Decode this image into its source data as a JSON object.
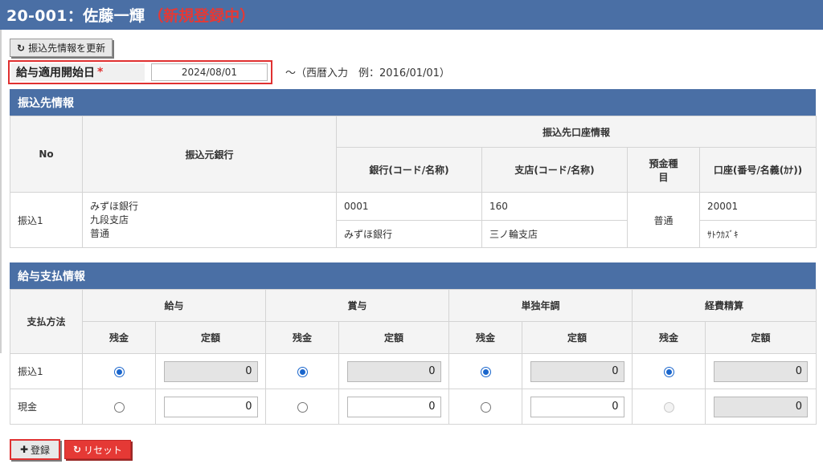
{
  "header": {
    "code_name": "20-001：佐藤一輝",
    "status": "（新規登録中）"
  },
  "toolbar": {
    "update_icon": "↻",
    "update_label": "振込先情報を更新"
  },
  "start_date": {
    "label": "給与適用開始日",
    "required_mark": "*",
    "value": "2024/08/01",
    "hint": "～（西暦入力　例：2016/01/01）"
  },
  "transfer": {
    "title": "振込先情報",
    "headers": {
      "no": "No",
      "source_bank": "振込元銀行",
      "dest_group": "振込先口座情報",
      "bank": "銀行(コード/名称)",
      "branch": "支店(コード/名称)",
      "deposit_type": "預金種目",
      "account": "口座(番号/名義(ｶﾅ))"
    },
    "row": {
      "no": "振込1",
      "src_bank": "みずほ銀行",
      "src_branch": "九段支店",
      "src_type": "普通",
      "bank_code": "0001",
      "bank_name": "みずほ銀行",
      "branch_code": "160",
      "branch_name": "三ノ輪支店",
      "deposit_type": "普通",
      "account_no": "20001",
      "account_name": "ｻﾄｳｶｽﾞｷ"
    }
  },
  "payment": {
    "title": "給与支払情報",
    "headers": {
      "method": "支払方法",
      "salary": "給与",
      "bonus": "賞与",
      "year_end": "単独年調",
      "expense": "経費精算",
      "remain": "残金",
      "fixed": "定額"
    },
    "rows": [
      {
        "label": "振込1",
        "amounts": [
          "0",
          "0",
          "0",
          "0"
        ]
      },
      {
        "label": "現金",
        "amounts": [
          "0",
          "0",
          "0",
          "0"
        ]
      }
    ]
  },
  "footer": {
    "register_icon": "✚",
    "register_label": "登録",
    "reset_icon": "↻",
    "reset_label": "リセット"
  }
}
